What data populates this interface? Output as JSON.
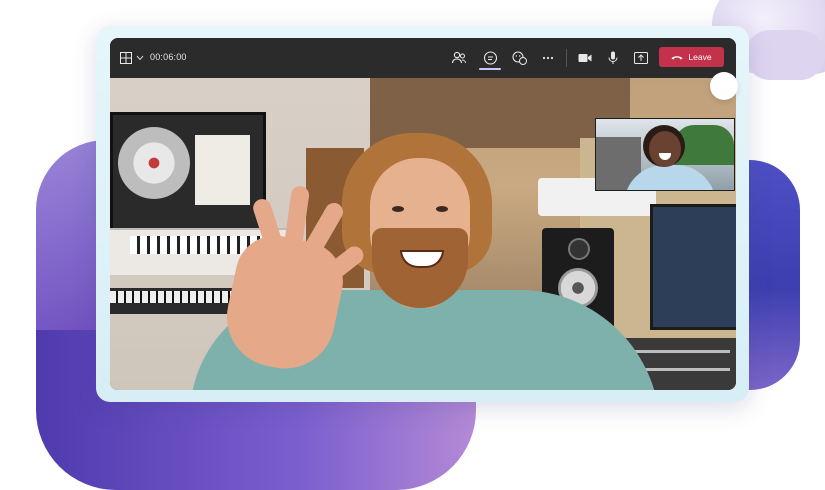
{
  "call": {
    "timer": "00:06:00",
    "leave_label": "Leave"
  },
  "toolbar": {
    "icons": [
      "layout-icon",
      "chevron-down-icon",
      "people-icon",
      "chat-icon",
      "reactions-icon",
      "more-icon",
      "camera-icon",
      "microphone-icon",
      "share-screen-icon",
      "phone-hangup-icon"
    ],
    "active": "chat-icon"
  },
  "colors": {
    "leave": "#c4314b",
    "topbar": "#2b2b2b",
    "accent_blob": "#6f4fc0"
  }
}
